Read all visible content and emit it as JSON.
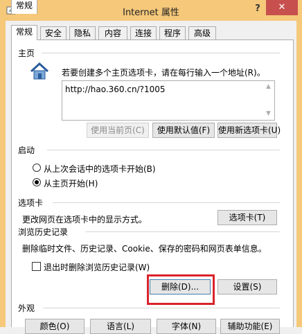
{
  "window": {
    "title": "Internet 属性",
    "help_glyph": "?",
    "close_glyph": "✕"
  },
  "tabs": [
    {
      "label": "常规",
      "active": true
    },
    {
      "label": "安全",
      "active": false
    },
    {
      "label": "隐私",
      "active": false
    },
    {
      "label": "内容",
      "active": false
    },
    {
      "label": "连接",
      "active": false
    },
    {
      "label": "程序",
      "active": false
    },
    {
      "label": "高级",
      "active": false
    }
  ],
  "homepage": {
    "section_label": "主页",
    "description": "若要创建多个主页选项卡，请在每行输入一个地址(R)。",
    "url_value": "http://hao.360.cn/?1005",
    "buttons": {
      "use_current": "使用当前页(C)",
      "use_default": "使用默认值(F)",
      "use_new_tab": "使用新选项卡(U)"
    }
  },
  "startup": {
    "section_label": "启动",
    "option_last_session": "从上次会话中的选项卡开始(B)",
    "option_homepage": "从主页开始(H)",
    "selected": "homepage"
  },
  "tabs_section": {
    "section_label": "选项卡",
    "description": "更改网页在选项卡中的显示方式。",
    "button": "选项卡(T)"
  },
  "history": {
    "section_label": "浏览历史记录",
    "description": "删除临时文件、历史记录、Cookie、保存的密码和网页表单信息。",
    "checkbox_label": "退出时删除浏览历史记录(W)",
    "checkbox_checked": false,
    "delete_button": "删除(D)...",
    "settings_button": "设置(S)"
  },
  "appearance": {
    "section_label": "外观",
    "buttons": {
      "colors": "颜色(O)",
      "languages": "语言(L)",
      "fonts": "字体(N)",
      "accessibility": "辅助功能(E)"
    }
  },
  "colors": {
    "title_bar": "#f5c87a",
    "close_button": "#c7504e",
    "highlight_box": "#d9232c"
  }
}
